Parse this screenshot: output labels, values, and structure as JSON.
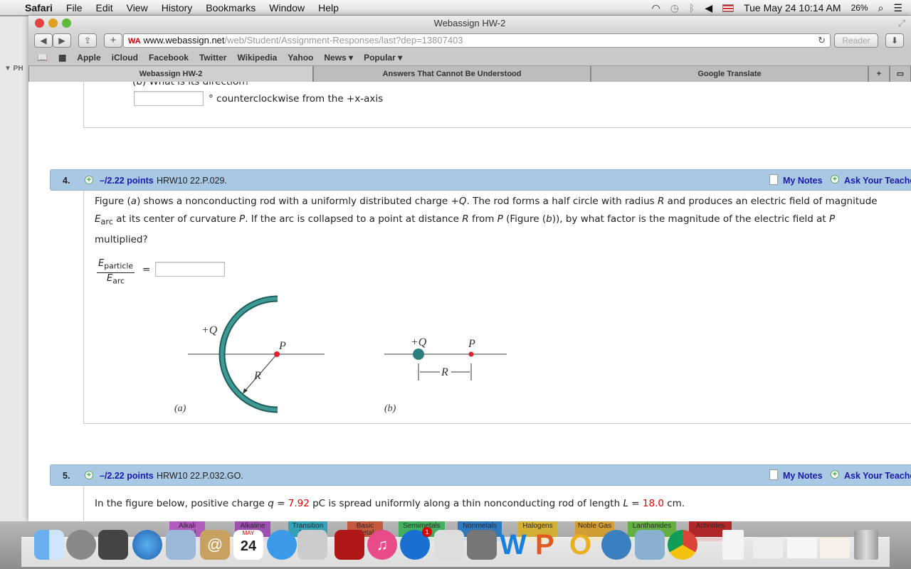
{
  "menubar": {
    "app": "Safari",
    "items": [
      "File",
      "Edit",
      "View",
      "History",
      "Bookmarks",
      "Window",
      "Help"
    ],
    "datetime": "Tue May 24  10:14 AM",
    "battery": "26%"
  },
  "window": {
    "title": "Webassign HW-2"
  },
  "toolbar": {
    "url_host": "www.webassign.net",
    "url_path": "/web/Student/Assignment-Responses/last?dep=13807403",
    "reader": "Reader"
  },
  "bookmarks": [
    "Apple",
    "iCloud",
    "Facebook",
    "Twitter",
    "Wikipedia",
    "Yahoo",
    "News ▾",
    "Popular ▾"
  ],
  "tabs": [
    {
      "label": "Webassign HW-2",
      "active": true
    },
    {
      "label": "Answers That Cannot Be Understood"
    },
    {
      "label": "Google Translate"
    }
  ],
  "background_window": {
    "label": "▼ PH"
  },
  "prev_question": {
    "part_b": "(b) What is its direction?",
    "suffix": "° counterclockwise from the +x-axis",
    "answer": ""
  },
  "q4": {
    "num": "4.",
    "points": "–/2.22 points",
    "code": "HRW10 22.P.029.",
    "my_notes": "My Notes",
    "ask": "Ask Your Teacher",
    "text_1": "Figure (",
    "a": "a",
    "text_2": ") shows a nonconducting rod with a uniformly distributed charge +",
    "Q": "Q",
    "text_3": ". The rod forms a half circle with radius ",
    "R": "R",
    "text_4": " and produces an electric field of magnitude ",
    "E": "E",
    "arc": "arc",
    "text_5": " at its center of curvature ",
    "P": "P",
    "text_6": ". If the arc is collapsed to a point at distance ",
    "text_7": " from ",
    "text_8": " (Figure (",
    "b": "b",
    "text_9": ")), by what factor is the magnitude of the electric field at ",
    "text_10": "multiplied?",
    "frac_num_sub": "particle",
    "equals": "=",
    "answer": "",
    "figure": {
      "plusQ": "+Q",
      "P": "P",
      "R": "R",
      "label_a": "(a)",
      "label_b": "(b)",
      "rod_color": "#2e7f7c",
      "point_color": "#e0202a"
    }
  },
  "q5": {
    "num": "5.",
    "points": "–/2.22 points",
    "code": "HRW10 22.P.032.GO.",
    "my_notes": "My Notes",
    "ask": "Ask Your Teacher",
    "text_1": "In the figure below, positive charge ",
    "q": "q",
    "text_2": " = ",
    "q_val": "7.92",
    "text_3": " pC is spread uniformly along a thin nonconducting rod of length ",
    "L": "L",
    "text_4": " = ",
    "L_val": "18.0",
    "text_5": " cm.",
    "value_color": "#e00000"
  },
  "dock": {
    "badge": "1",
    "calendar_month": "MAY",
    "calendar_day": "24",
    "periodic_labels": [
      "Alkali Metal",
      "Alkaline Earth",
      "Transition Metal",
      "Basic Metal",
      "Semimetals",
      "Nonmetals",
      "Halogens",
      "Noble Gas",
      "Lanthanides",
      "Actinides"
    ]
  }
}
